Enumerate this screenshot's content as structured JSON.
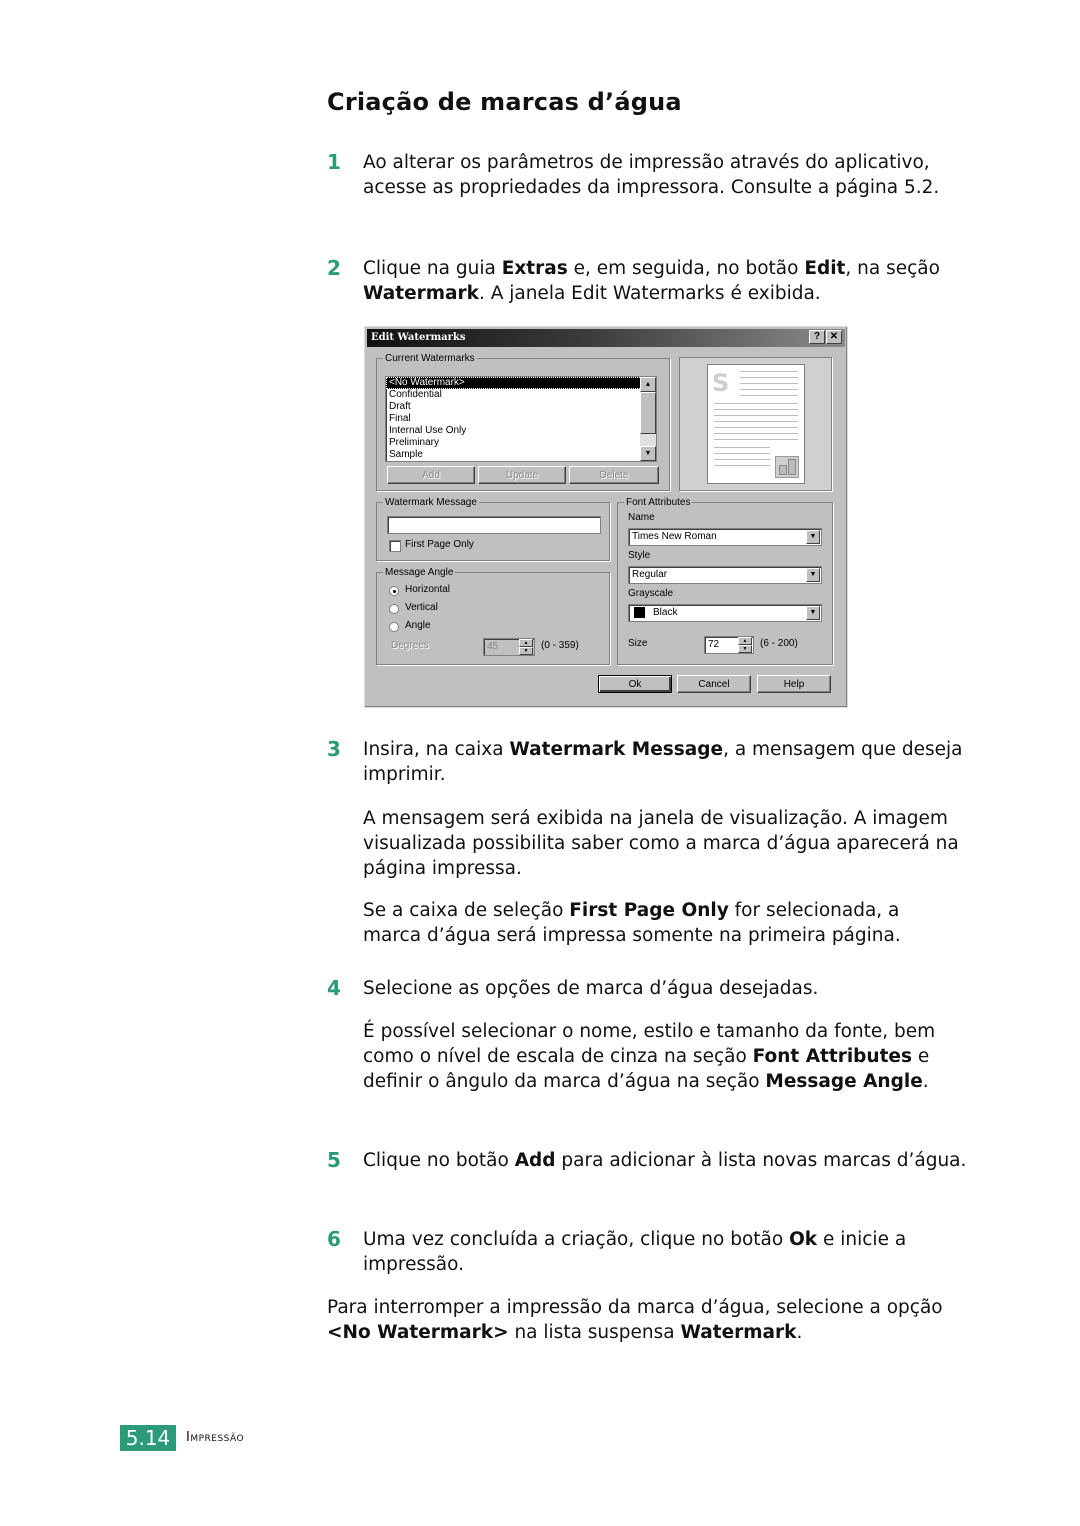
{
  "page": {
    "title": "Criação de marcas d’água",
    "steps": [
      {
        "number": "1",
        "segments": [
          {
            "t": "Ao alterar os parâmetros de impressão através do aplicativo, acesse as propriedades da impressora. Consulte a página 5.2."
          }
        ]
      },
      {
        "number": "2",
        "segments": [
          {
            "t": "Clique na guia "
          },
          {
            "t": "Extras",
            "b": true
          },
          {
            "t": " e, em seguida, no botão "
          },
          {
            "t": "Edit",
            "b": true
          },
          {
            "t": ", na seção "
          },
          {
            "t": "Watermark",
            "b": true
          },
          {
            "t": ". A janela Edit Watermarks é exibida."
          }
        ]
      },
      {
        "number": "3",
        "segments": [
          {
            "t": "Insira, na caixa "
          },
          {
            "t": "Watermark Message",
            "b": true
          },
          {
            "t": ", a mensagem que deseja imprimir."
          }
        ]
      },
      {
        "number": "4",
        "segments": [
          {
            "t": "Selecione as opções de marca d’água desejadas."
          }
        ]
      },
      {
        "number": "5",
        "segments": [
          {
            "t": "Clique no botão "
          },
          {
            "t": "Add",
            "b": true
          },
          {
            "t": " para adicionar à lista novas marcas d’água."
          }
        ]
      },
      {
        "number": "6",
        "segments": [
          {
            "t": "Uma vez concluída a criação, clique no botão "
          },
          {
            "t": "Ok",
            "b": true
          },
          {
            "t": " e inicie a impressão."
          }
        ]
      }
    ],
    "step3_notes": [
      [
        {
          "t": "A mensagem será exibida na janela de visualização. A imagem visualizada possibilita saber como a marca d’água aparecerá na página impressa."
        }
      ],
      [
        {
          "t": "Se a caixa de seleção "
        },
        {
          "t": "First Page Only",
          "b": true
        },
        {
          "t": " for selecionada, a marca d’água será impressa somente na primeira página."
        }
      ]
    ],
    "step4_note": [
      {
        "t": "É possível selecionar o nome, estilo e tamanho da fonte, bem como o nível de escala de cinza na seção "
      },
      {
        "t": "Font Attributes",
        "b": true
      },
      {
        "t": " e definir o ângulo da marca d’água na seção "
      },
      {
        "t": "Message Angle",
        "b": true
      },
      {
        "t": "."
      }
    ],
    "closing": [
      {
        "t": "Para interromper a impressão da marca d’água, selecione a opção "
      },
      {
        "t": "<No Watermark>",
        "b": true
      },
      {
        "t": " na lista suspensa "
      },
      {
        "t": "Watermark",
        "b": true
      },
      {
        "t": "."
      }
    ]
  },
  "dialog": {
    "title": "Edit Watermarks",
    "help_button": "?",
    "close_button": "✕",
    "current_watermarks": {
      "legend": "Current Watermarks",
      "items": [
        "<No Watermark>",
        "Confidential",
        "Draft",
        "Final",
        "Internal Use Only",
        "Preliminary",
        "Sample"
      ],
      "selected": "<No Watermark>",
      "buttons": {
        "add": "Add",
        "update": "Update",
        "delete": "Delete"
      }
    },
    "preview": {
      "letter": "S"
    },
    "watermark_message": {
      "legend": "Watermark Message",
      "value": "",
      "first_page_only_label": "First Page Only",
      "first_page_only_checked": false
    },
    "message_angle": {
      "legend": "Message Angle",
      "options": [
        "Horizontal",
        "Vertical",
        "Angle"
      ],
      "selected": "Horizontal",
      "degrees_label": "Degrees",
      "degrees_value": "45",
      "degrees_range": "(0 - 359)"
    },
    "font_attributes": {
      "legend": "Font Attributes",
      "name_label": "Name",
      "name_value": "Times New Roman",
      "style_label": "Style",
      "style_value": "Regular",
      "grayscale_label": "Grayscale",
      "grayscale_value": "Black",
      "grayscale_color": "#000000",
      "size_label": "Size",
      "size_value": "72",
      "size_range": "(6 - 200)"
    },
    "buttons": {
      "ok": "Ok",
      "cancel": "Cancel",
      "help": "Help"
    }
  },
  "footer": {
    "page_number": "5.14",
    "section": "Impressão",
    "accent_color": "#2a9a78"
  }
}
